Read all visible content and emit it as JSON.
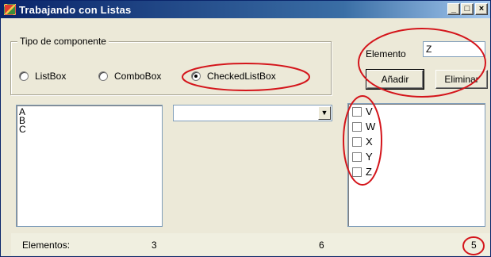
{
  "window": {
    "title": "Trabajando con Listas",
    "controls": {
      "minimize": "_",
      "maximize": "□",
      "close": "×"
    }
  },
  "group": {
    "legend": "Tipo de componente",
    "options": [
      {
        "label": "ListBox",
        "checked": false
      },
      {
        "label": "ComboBox",
        "checked": false
      },
      {
        "label": "CheckedListBox",
        "checked": true
      }
    ]
  },
  "element": {
    "label": "Elemento",
    "value": "Z",
    "add_label": "Añadir",
    "remove_label": "Eliminar"
  },
  "listbox": {
    "items": [
      "A",
      "B",
      "C"
    ]
  },
  "combobox": {
    "value": ""
  },
  "checkedlist": {
    "items": [
      {
        "label": "V",
        "checked": false
      },
      {
        "label": "W",
        "checked": false
      },
      {
        "label": "X",
        "checked": false
      },
      {
        "label": "Y",
        "checked": false
      },
      {
        "label": "Z",
        "checked": false
      }
    ]
  },
  "status": {
    "label": "Elementos:",
    "listbox_count": "3",
    "combobox_count": "6",
    "checkedlist_count": "5"
  },
  "colors": {
    "annotation": "#d4151b",
    "titlebar": "#0a246a"
  }
}
